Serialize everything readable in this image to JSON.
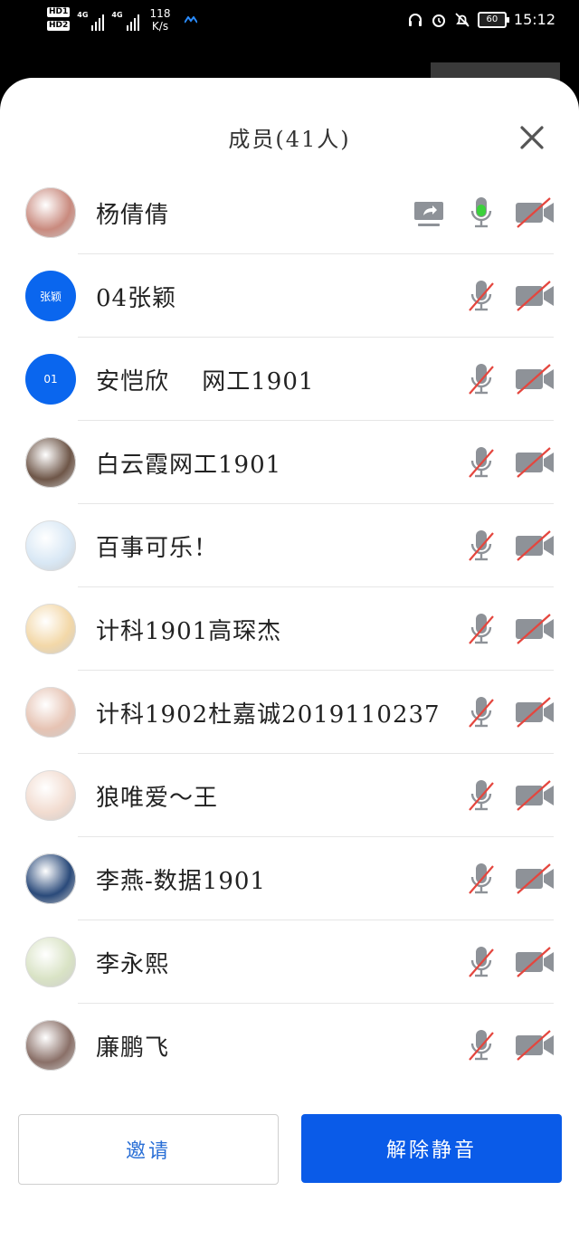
{
  "status_bar": {
    "hd1": "HD1",
    "hd2": "HD2",
    "net1": "4G",
    "net2": "4G",
    "speed_value": "118",
    "speed_unit": "K/s",
    "battery": "60",
    "time": "15:12"
  },
  "panel": {
    "title": "成员(41人)"
  },
  "members": [
    {
      "name": "杨倩倩",
      "avatar_type": "photo",
      "avatar_color": "#c98a7e",
      "sharing": true,
      "mic": "active",
      "camera": "off"
    },
    {
      "name": "04张颖",
      "avatar_type": "text",
      "avatar_text": "张颖",
      "avatar_color": "#0a66ee",
      "mic": "muted",
      "camera": "off"
    },
    {
      "name": "安恺欣　 网工1901",
      "avatar_type": "text",
      "avatar_text": "01",
      "avatar_color": "#0a66ee",
      "mic": "muted",
      "camera": "off"
    },
    {
      "name": "白云霞网工1901",
      "avatar_type": "photo",
      "avatar_color": "#6e5648",
      "mic": "muted",
      "camera": "off"
    },
    {
      "name": "百事可乐！",
      "avatar_type": "photo",
      "avatar_color": "#d9e8f5",
      "mic": "muted",
      "camera": "off"
    },
    {
      "name": "计科1901高琛杰",
      "avatar_type": "photo",
      "avatar_color": "#f3d8a8",
      "mic": "muted",
      "camera": "off"
    },
    {
      "name": "计科1902杜嘉诚2019110237",
      "avatar_type": "photo",
      "avatar_color": "#e6c3b3",
      "mic": "muted",
      "camera": "off"
    },
    {
      "name": "狼唯爱～王",
      "avatar_type": "photo",
      "avatar_color": "#f2dcd0",
      "mic": "muted",
      "camera": "off"
    },
    {
      "name": "李燕-数据1901",
      "avatar_type": "photo",
      "avatar_color": "#2a4a7a",
      "mic": "muted",
      "camera": "off"
    },
    {
      "name": "李永熙",
      "avatar_type": "photo",
      "avatar_color": "#d9e3c5",
      "mic": "muted",
      "camera": "off"
    },
    {
      "name": "廉鹏飞",
      "avatar_type": "photo",
      "avatar_color": "#8a7068",
      "mic": "muted",
      "camera": "off"
    }
  ],
  "buttons": {
    "invite": "邀请",
    "unmute_all": "解除静音"
  },
  "colors": {
    "primary": "#0a5be8",
    "mic_active": "#3bd13b",
    "muted_slash": "#e4463e",
    "icon_gray": "#8e9298"
  }
}
